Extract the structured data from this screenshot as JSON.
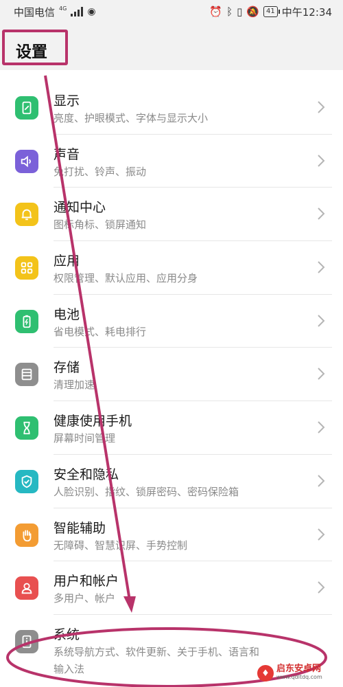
{
  "statusbar": {
    "carrier": "中国电信",
    "net": "4G",
    "battery": "41",
    "time": "中午12:34"
  },
  "header": {
    "title": "设置"
  },
  "partial_prev": "   ",
  "items": [
    {
      "title": "显示",
      "subtitle": "亮度、护眼模式、字体与显示大小",
      "icon": "display-icon",
      "color": "#2fbf71"
    },
    {
      "title": "声音",
      "subtitle": "免打扰、铃声、振动",
      "icon": "sound-icon",
      "color": "#7b61d9"
    },
    {
      "title": "通知中心",
      "subtitle": "图标角标、锁屏通知",
      "icon": "bell-icon",
      "color": "#f3c31a"
    },
    {
      "title": "应用",
      "subtitle": "权限管理、默认应用、应用分身",
      "icon": "apps-icon",
      "color": "#f3c31a"
    },
    {
      "title": "电池",
      "subtitle": "省电模式、耗电排行",
      "icon": "battery-icon",
      "color": "#2fbf71"
    },
    {
      "title": "存储",
      "subtitle": "清理加速",
      "icon": "storage-icon",
      "color": "#8e8e8e"
    },
    {
      "title": "健康使用手机",
      "subtitle": "屏幕时间管理",
      "icon": "hourglass-icon",
      "color": "#2fbf71"
    },
    {
      "title": "安全和隐私",
      "subtitle": "人脸识别、指纹、锁屏密码、密码保险箱",
      "icon": "shield-icon",
      "color": "#26b8c2"
    },
    {
      "title": "智能辅助",
      "subtitle": "无障碍、智慧识屏、手势控制",
      "icon": "hand-icon",
      "color": "#f39c33"
    },
    {
      "title": "用户和帐户",
      "subtitle": "多用户、帐户",
      "icon": "user-icon",
      "color": "#e85050"
    },
    {
      "title": "系统",
      "subtitle": "系统导航方式、软件更新、关于手机、语言和",
      "subtitle2": "输入法",
      "icon": "info-icon",
      "color": "#8e8e8e"
    }
  ],
  "watermark": {
    "main": "启东安卓网",
    "url": "www.qdltdq.com"
  },
  "colors": {
    "annotation": "#b8336a"
  }
}
